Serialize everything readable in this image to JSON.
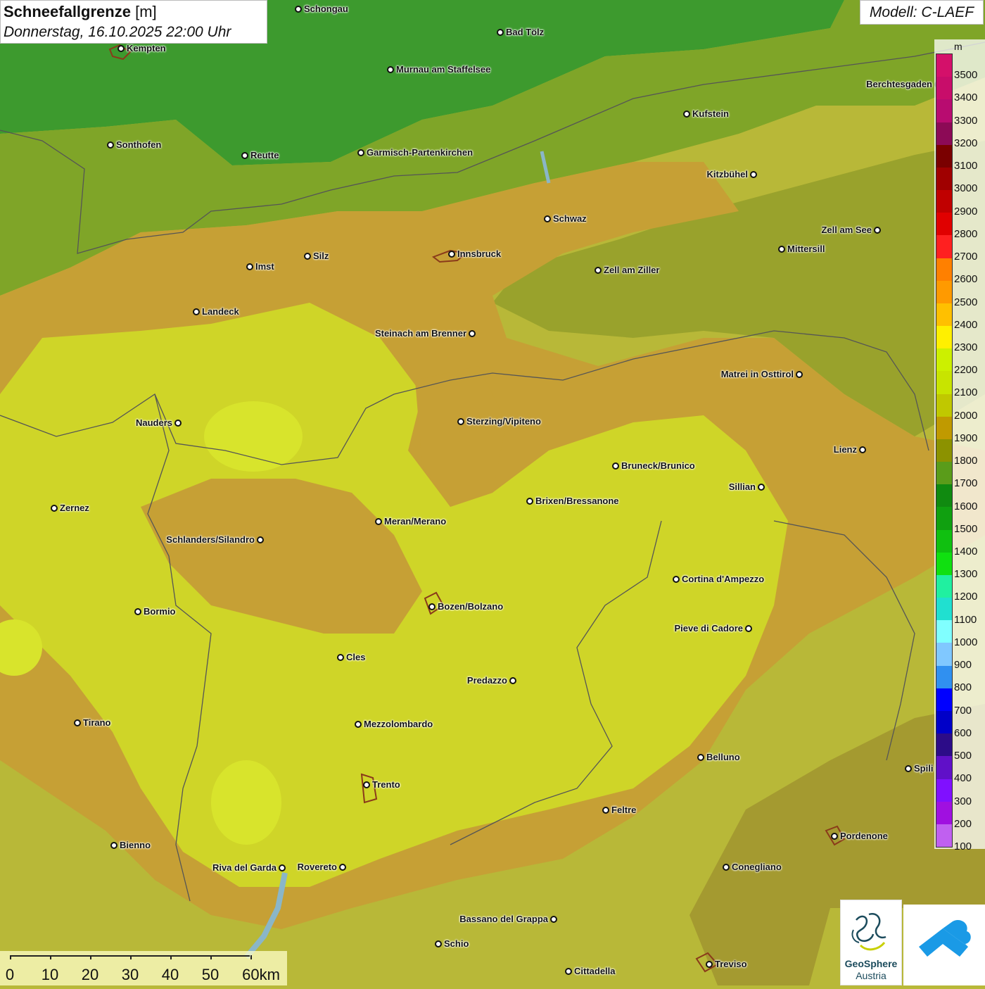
{
  "title": {
    "name": "Schneefallgrenze",
    "unit": "[m]",
    "datetime": "Donnerstag, 16.10.2025 22:00 Uhr"
  },
  "model_label": "Modell: C-LAEF",
  "legend": {
    "unit": "m",
    "labels": [
      "3500",
      "3400",
      "3300",
      "3200",
      "3100",
      "3000",
      "2900",
      "2800",
      "2700",
      "2600",
      "2500",
      "2400",
      "2300",
      "2200",
      "2100",
      "2000",
      "1900",
      "1800",
      "1700",
      "1600",
      "1500",
      "1400",
      "1300",
      "1200",
      "1100",
      "1000",
      "900",
      "800",
      "700",
      "600",
      "500",
      "400",
      "300",
      "200",
      "100"
    ],
    "colors": [
      "#d4106a",
      "#c80d6a",
      "#b80c70",
      "#8c0a56",
      "#7a0000",
      "#a00000",
      "#c00000",
      "#e00000",
      "#ff2020",
      "#ff8000",
      "#ff9a00",
      "#ffc000",
      "#fff000",
      "#ccf000",
      "#c8e400",
      "#c0c800",
      "#c09a00",
      "#8c9200",
      "#5a9c1a",
      "#108a10",
      "#10a010",
      "#10c010",
      "#10e010",
      "#20f0a0",
      "#20e0d0",
      "#80ffff",
      "#80c8ff",
      "#3090f0",
      "#0000ff",
      "#0000c8",
      "#2c0c88",
      "#6010c8",
      "#8010ff",
      "#a010e0",
      "#c060f0"
    ]
  },
  "cities": [
    {
      "name": "Schongau",
      "label_side": "right"
    },
    {
      "name": "Bad Tölz",
      "label_side": "right"
    },
    {
      "name": "Kempten",
      "label_side": "right"
    },
    {
      "name": "Murnau am Staffelsee",
      "label_side": "right"
    },
    {
      "name": "Berchtesgaden",
      "label_side": "left"
    },
    {
      "name": "Kufstein",
      "label_side": "right"
    },
    {
      "name": "Sonthofen",
      "label_side": "right"
    },
    {
      "name": "Reutte",
      "label_side": "right"
    },
    {
      "name": "Garmisch-Partenkirchen",
      "label_side": "right"
    },
    {
      "name": "Kitzbühel",
      "label_side": "left"
    },
    {
      "name": "Schwaz",
      "label_side": "right"
    },
    {
      "name": "Zell am See",
      "label_side": "left"
    },
    {
      "name": "Innsbruck",
      "label_side": "right"
    },
    {
      "name": "Mittersill",
      "label_side": "right"
    },
    {
      "name": "Imst",
      "label_side": "right"
    },
    {
      "name": "Silz",
      "label_side": "right"
    },
    {
      "name": "Zell am Ziller",
      "label_side": "right"
    },
    {
      "name": "Landeck",
      "label_side": "right"
    },
    {
      "name": "Steinach am Brenner",
      "label_side": "left"
    },
    {
      "name": "Matrei in Osttirol",
      "label_side": "left"
    },
    {
      "name": "Nauders",
      "label_side": "left"
    },
    {
      "name": "Sterzing/Vipiteno",
      "label_side": "right"
    },
    {
      "name": "Lienz",
      "label_side": "left"
    },
    {
      "name": "Bruneck/Brunico",
      "label_side": "right"
    },
    {
      "name": "Sillian",
      "label_side": "left"
    },
    {
      "name": "Brixen/Bressanone",
      "label_side": "right"
    },
    {
      "name": "Zernez",
      "label_side": "right"
    },
    {
      "name": "Meran/Merano",
      "label_side": "right"
    },
    {
      "name": "Schlanders/Silandro",
      "label_side": "left"
    },
    {
      "name": "Cortina d'Ampezzo",
      "label_side": "right"
    },
    {
      "name": "Bormio",
      "label_side": "right"
    },
    {
      "name": "Bozen/Bolzano",
      "label_side": "right"
    },
    {
      "name": "Pieve di Cadore",
      "label_side": "left"
    },
    {
      "name": "Cles",
      "label_side": "right"
    },
    {
      "name": "Predazzo",
      "label_side": "left"
    },
    {
      "name": "Tirano",
      "label_side": "right"
    },
    {
      "name": "Mezzolombardo",
      "label_side": "right"
    },
    {
      "name": "Belluno",
      "label_side": "right"
    },
    {
      "name": "Spili",
      "label_side": "right"
    },
    {
      "name": "Trento",
      "label_side": "right"
    },
    {
      "name": "Feltre",
      "label_side": "right"
    },
    {
      "name": "Pordenone",
      "label_side": "right"
    },
    {
      "name": "Bienno",
      "label_side": "right"
    },
    {
      "name": "Riva del Garda",
      "label_side": "left"
    },
    {
      "name": "Rovereto",
      "label_side": "left"
    },
    {
      "name": "Conegliano",
      "label_side": "right"
    },
    {
      "name": "Bassano del Grappa",
      "label_side": "left"
    },
    {
      "name": "Schio",
      "label_side": "right"
    },
    {
      "name": "Treviso",
      "label_side": "right"
    },
    {
      "name": "Cittadella",
      "label_side": "right"
    }
  ],
  "scale_bar": {
    "labels": [
      "0",
      "10",
      "20",
      "30",
      "40",
      "50",
      "60km"
    ]
  },
  "logos": {
    "geosphere_name": "GeoSphere",
    "geosphere_sub": "Austria"
  }
}
